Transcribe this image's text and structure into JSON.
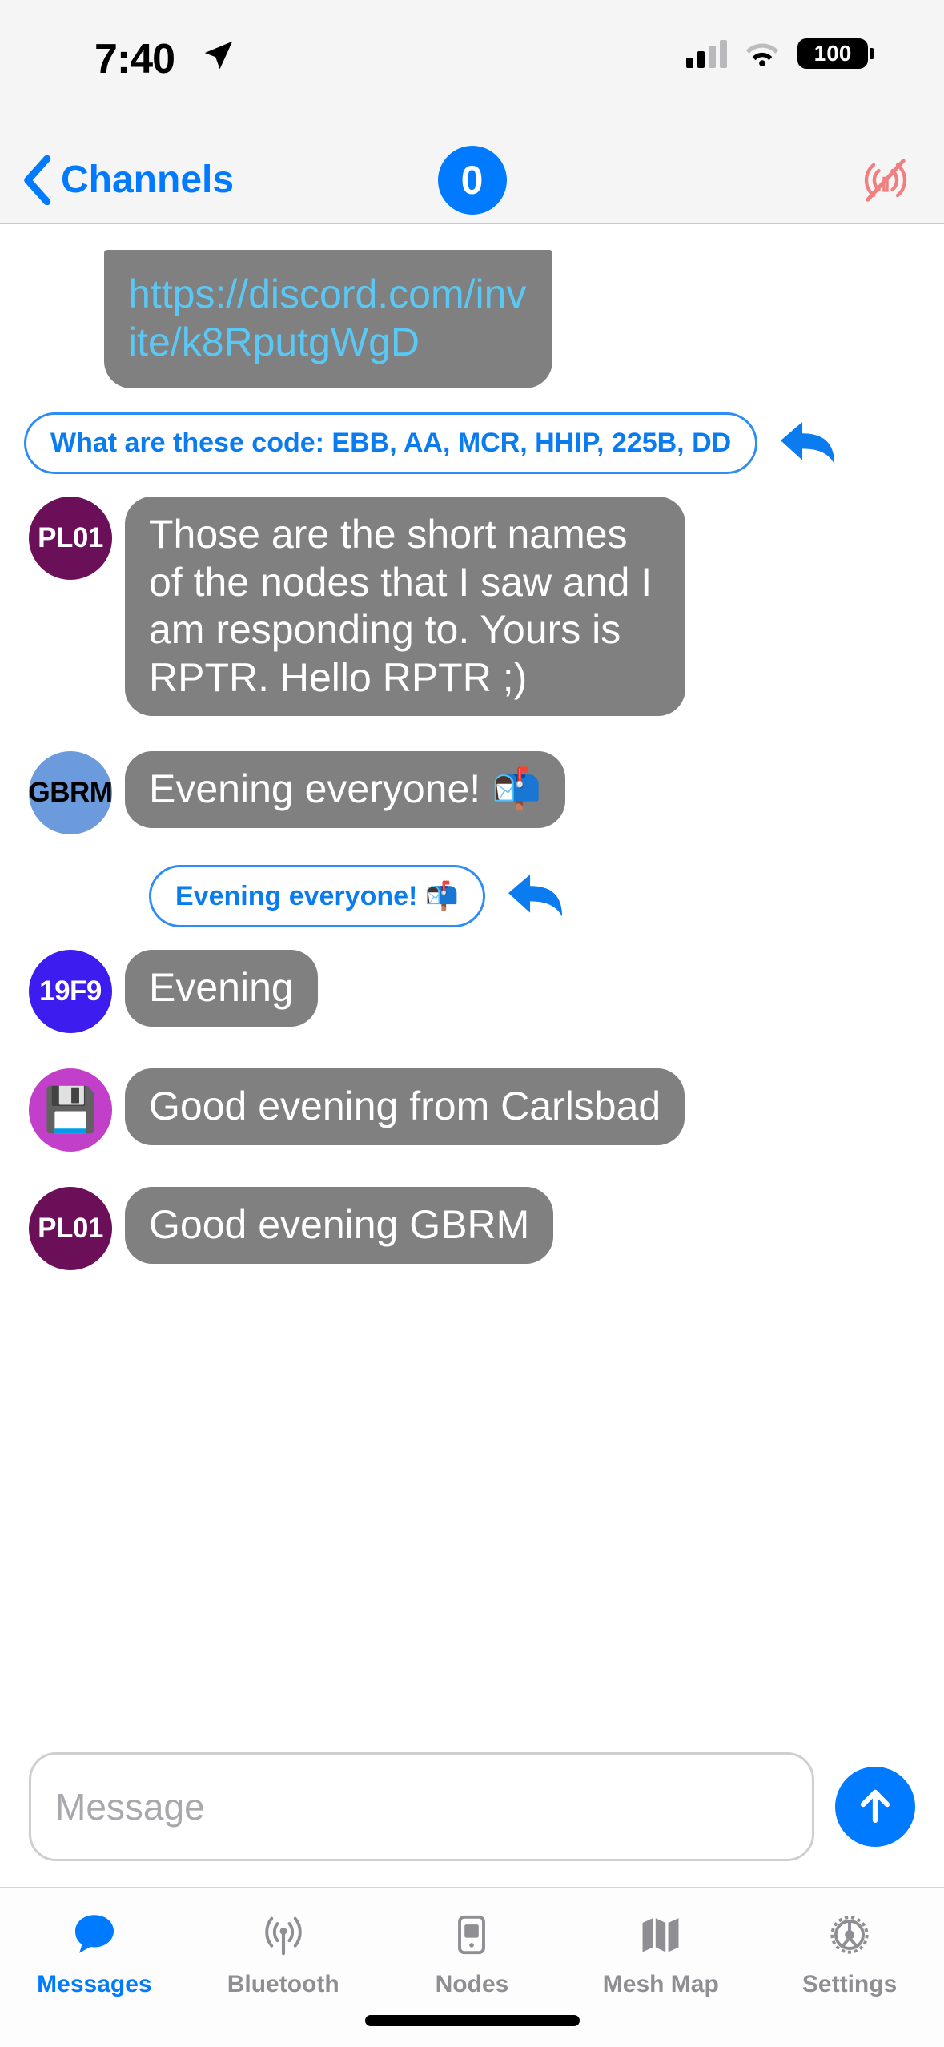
{
  "status_bar": {
    "time": "7:40",
    "location_icon": "location-arrow-icon",
    "cellular_icon": "cellular-bars-icon",
    "wifi_icon": "wifi-icon",
    "battery_level": "100"
  },
  "nav_bar": {
    "back_label": "Channels",
    "back_icon": "chevron-left-icon",
    "channel_badge": "0",
    "right_icon": "no-signal-icon",
    "right_icon_color": "#f08080"
  },
  "theme": {
    "accent": "#007aff",
    "bubble_incoming": "#808080",
    "bubble_text": "#ffffff",
    "link_color": "#5ac8f5",
    "outline_blue": "#2d8cf5"
  },
  "messages": [
    {
      "type": "incoming-link",
      "text": "https://discord.com/invite/k8RputgWgD"
    },
    {
      "type": "outgoing",
      "text": "What are these code:  EBB, AA, MCR, HHIP, 225B, DD"
    },
    {
      "type": "incoming",
      "avatar": "PL01",
      "avatar_color": "#6b0f58",
      "avatar_text_color": "#ffffff",
      "text": "Those are the short names of the nodes that I saw and I am responding to.  Yours is RPTR.  Hello RPTR ;)"
    },
    {
      "type": "incoming",
      "avatar": "GBRM",
      "avatar_color": "#6b9bdc",
      "avatar_text_color": "#000000",
      "text": "Evening everyone! 📬"
    },
    {
      "type": "outgoing",
      "text": "Evening everyone! 📬"
    },
    {
      "type": "incoming",
      "avatar": "19F9",
      "avatar_color": "#3d1cf0",
      "avatar_text_color": "#ffffff",
      "text": "Evening"
    },
    {
      "type": "incoming",
      "avatar": "💾",
      "avatar_is_emoji": true,
      "avatar_color": "#c13fc9",
      "avatar_text_color": "#ffffff",
      "text": "Good evening from Carlsbad"
    },
    {
      "type": "incoming",
      "avatar": "PL01",
      "avatar_color": "#6b0f58",
      "avatar_text_color": "#ffffff",
      "text": "Good evening GBRM"
    }
  ],
  "composer": {
    "placeholder": "Message",
    "value": "",
    "send_icon": "arrow-up-icon"
  },
  "tab_bar": {
    "active_index": 0,
    "items": [
      {
        "label": "Messages",
        "icon": "chat-bubble-icon"
      },
      {
        "label": "Bluetooth",
        "icon": "antenna-signal-icon"
      },
      {
        "label": "Nodes",
        "icon": "mobile-phone-icon"
      },
      {
        "label": "Mesh Map",
        "icon": "folded-map-icon"
      },
      {
        "label": "Settings",
        "icon": "gear-icon"
      }
    ]
  }
}
